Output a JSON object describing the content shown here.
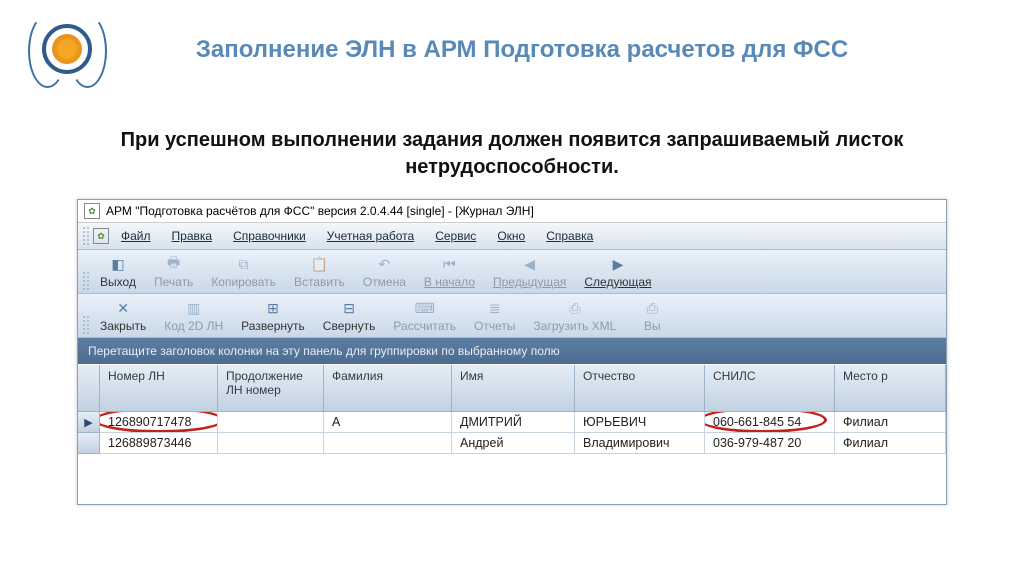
{
  "slide": {
    "title": "Заполнение ЭЛН в АРМ Подготовка расчетов для ФСС",
    "caption_l1": "При успешном выполнении задания должен появится запрашиваемый листок",
    "caption_l2": "нетрудоспособности."
  },
  "window": {
    "title": "АРМ \"Подготовка расчётов для ФСС\"  версия 2.0.4.44 [single] - [Журнал ЭЛН]"
  },
  "menu": {
    "file": "Файл",
    "edit": "Правка",
    "catalogs": "Справочники",
    "accounting": "Учетная работа",
    "service": "Сервис",
    "window": "Окно",
    "help": "Справка"
  },
  "tb1": {
    "exit": "Выход",
    "print": "Печать",
    "copy": "Копировать",
    "paste": "Вставить",
    "undo": "Отмена",
    "first": "В начало",
    "prev": "Предыдущая",
    "next": "Следующая"
  },
  "tb2": {
    "close": "Закрыть",
    "kod2d": "Код 2D  ЛН",
    "expand": "Развернуть",
    "collapse": "Свернуть",
    "calc": "Рассчитать",
    "reports": "Отчеты",
    "loadxml": "Загрузить XML",
    "vy": "Вы"
  },
  "grid": {
    "hint": "Перетащите заголовок колонки на эту панель для группировки по выбранному полю",
    "headers": {
      "ln": "Номер ЛН",
      "cont": "Продолжение ЛН номер",
      "fam": "Фамилия",
      "name": "Имя",
      "pat": "Отчество",
      "snils": "СНИЛС",
      "place": "Место р"
    },
    "rows": [
      {
        "ln": "126890717478",
        "cont": "",
        "fam": "А",
        "name": "ДМИТРИЙ",
        "pat": "ЮРЬЕВИЧ",
        "snils": "060-661-845 54",
        "place": "Филиал"
      },
      {
        "ln": "126889873446",
        "cont": "",
        "fam": " ",
        "name": "Андрей",
        "pat": "Владимирович",
        "snils": "036-979-487 20",
        "place": "Филиал"
      }
    ]
  }
}
